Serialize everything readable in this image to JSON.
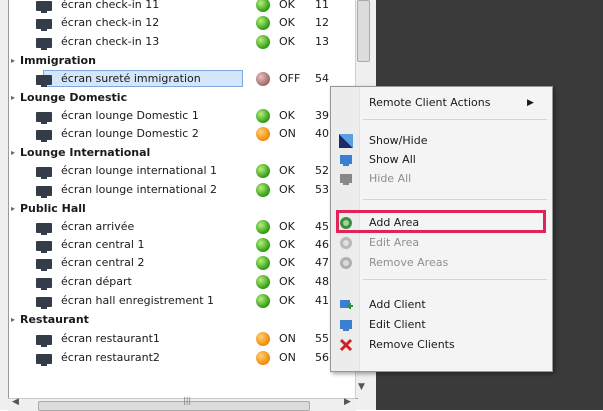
{
  "tree": {
    "rows": [
      {
        "type": "item",
        "name": "écran check-in 11",
        "status": "OK",
        "dot": "green",
        "count": "11"
      },
      {
        "type": "item",
        "name": "écran check-in 12",
        "status": "OK",
        "dot": "green",
        "count": "12"
      },
      {
        "type": "item",
        "name": "écran check-in 13",
        "status": "OK",
        "dot": "green",
        "count": "13"
      },
      {
        "type": "group",
        "name": "Immigration"
      },
      {
        "type": "item",
        "name": "écran sureté immigration",
        "status": "OFF",
        "dot": "grey",
        "count": "54",
        "selected": true
      },
      {
        "type": "group",
        "name": "Lounge Domestic"
      },
      {
        "type": "item",
        "name": "écran lounge Domestic 1",
        "status": "OK",
        "dot": "green",
        "count": "39"
      },
      {
        "type": "item",
        "name": "écran lounge Domestic 2",
        "status": "ON",
        "dot": "orange",
        "count": "40"
      },
      {
        "type": "group",
        "name": "Lounge International"
      },
      {
        "type": "item",
        "name": "écran lounge international 1",
        "status": "OK",
        "dot": "green",
        "count": "52"
      },
      {
        "type": "item",
        "name": "écran lounge international 2",
        "status": "OK",
        "dot": "green",
        "count": "53"
      },
      {
        "type": "group",
        "name": "Public Hall"
      },
      {
        "type": "item",
        "name": "écran arrivée",
        "status": "OK",
        "dot": "green",
        "count": "45"
      },
      {
        "type": "item",
        "name": "écran central 1",
        "status": "OK",
        "dot": "green",
        "count": "46"
      },
      {
        "type": "item",
        "name": "écran central 2",
        "status": "OK",
        "dot": "green",
        "count": "47"
      },
      {
        "type": "item",
        "name": "écran départ",
        "status": "OK",
        "dot": "green",
        "count": "48"
      },
      {
        "type": "item",
        "name": "écran hall enregistrement 1",
        "status": "OK",
        "dot": "green",
        "count": "41"
      },
      {
        "type": "group",
        "name": "Restaurant"
      },
      {
        "type": "item",
        "name": "écran restaurant1",
        "status": "ON",
        "dot": "orange",
        "count": "55"
      },
      {
        "type": "item",
        "name": "écran restaurant2",
        "status": "ON",
        "dot": "orange",
        "count": "56"
      }
    ]
  },
  "context_menu": {
    "items": [
      {
        "label": "Remote Client Actions",
        "icon": "",
        "submenu": true,
        "disabled": false
      },
      {
        "separator": true
      },
      {
        "label": "Show/Hide",
        "icon": "show-hide-icon",
        "disabled": false
      },
      {
        "label": "Show All",
        "icon": "show-all-icon",
        "disabled": false
      },
      {
        "label": "Hide All",
        "icon": "hide-all-icon",
        "disabled": true
      },
      {
        "separator": true
      },
      {
        "label": "Add Area",
        "icon": "add-area-icon",
        "disabled": false,
        "highlighted": true
      },
      {
        "label": "Edit Area",
        "icon": "edit-area-icon",
        "disabled": true
      },
      {
        "label": "Remove Areas",
        "icon": "remove-areas-icon",
        "disabled": true
      },
      {
        "separator": true
      },
      {
        "label": "Add Client",
        "icon": "add-client-icon",
        "disabled": false
      },
      {
        "label": "Edit Client",
        "icon": "edit-client-icon",
        "disabled": false
      },
      {
        "label": "Remove Clients",
        "icon": "remove-clients-icon",
        "disabled": false
      }
    ]
  },
  "colors": {
    "highlight_border": "#e0245a",
    "selection": "#d3e6fb",
    "status_green": "#2d9a12",
    "status_orange": "#f08a00"
  }
}
